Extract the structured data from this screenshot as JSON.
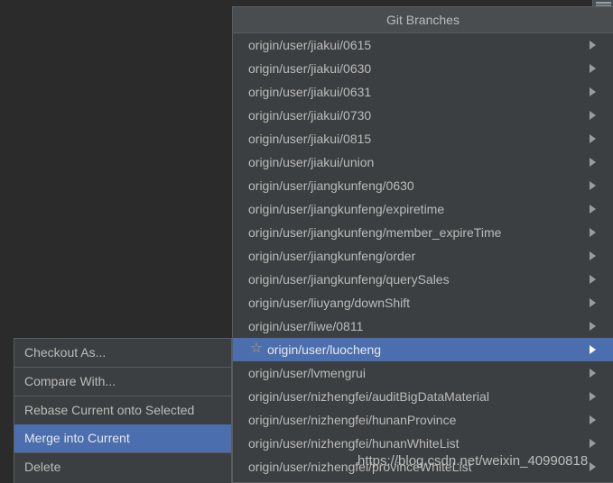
{
  "window": {
    "background_color": "#2b2b2b",
    "corner_widget_name": "scrollbar-fragment"
  },
  "branches_popup": {
    "title": "Git Branches",
    "accent_color": "#4b6eaf",
    "background_color": "#3c3f41",
    "star_color": "#d9a343",
    "items": [
      {
        "label": "origin/user/jiakui/0615",
        "starred": false,
        "selected": false,
        "has_submenu": true
      },
      {
        "label": "origin/user/jiakui/0630",
        "starred": false,
        "selected": false,
        "has_submenu": true
      },
      {
        "label": "origin/user/jiakui/0631",
        "starred": false,
        "selected": false,
        "has_submenu": true
      },
      {
        "label": "origin/user/jiakui/0730",
        "starred": false,
        "selected": false,
        "has_submenu": true
      },
      {
        "label": "origin/user/jiakui/0815",
        "starred": false,
        "selected": false,
        "has_submenu": true
      },
      {
        "label": "origin/user/jiakui/union",
        "starred": false,
        "selected": false,
        "has_submenu": true
      },
      {
        "label": "origin/user/jiangkunfeng/0630",
        "starred": false,
        "selected": false,
        "has_submenu": true
      },
      {
        "label": "origin/user/jiangkunfeng/expiretime",
        "starred": false,
        "selected": false,
        "has_submenu": true
      },
      {
        "label": "origin/user/jiangkunfeng/member_expireTime",
        "starred": false,
        "selected": false,
        "has_submenu": true
      },
      {
        "label": "origin/user/jiangkunfeng/order",
        "starred": false,
        "selected": false,
        "has_submenu": true
      },
      {
        "label": "origin/user/jiangkunfeng/querySales",
        "starred": false,
        "selected": false,
        "has_submenu": true
      },
      {
        "label": "origin/user/liuyang/downShift",
        "starred": false,
        "selected": false,
        "has_submenu": true
      },
      {
        "label": "origin/user/liwe/0811",
        "starred": false,
        "selected": false,
        "has_submenu": true
      },
      {
        "label": "origin/user/luocheng",
        "starred": true,
        "selected": true,
        "has_submenu": true
      },
      {
        "label": "origin/user/lvmengrui",
        "starred": false,
        "selected": false,
        "has_submenu": true
      },
      {
        "label": "origin/user/nizhengfei/auditBigDataMaterial",
        "starred": false,
        "selected": false,
        "has_submenu": true
      },
      {
        "label": "origin/user/nizhengfei/hunanProvince",
        "starred": false,
        "selected": false,
        "has_submenu": true
      },
      {
        "label": "origin/user/nizhengfei/hunanWhiteList",
        "starred": false,
        "selected": false,
        "has_submenu": true
      },
      {
        "label": "origin/user/nizhengfei/provinceWhiteList",
        "starred": false,
        "selected": false,
        "has_submenu": true
      }
    ],
    "star_glyph": "☆",
    "submenu_glyph": "▶"
  },
  "context_menu": {
    "highlight_color": "#4b6eaf",
    "items": [
      {
        "label": "Checkout As...",
        "highlighted": false,
        "separator_after": true
      },
      {
        "label": "Compare With...",
        "highlighted": false,
        "separator_after": true
      },
      {
        "label": "Rebase Current onto Selected",
        "highlighted": false,
        "separator_after": false
      },
      {
        "label": "Merge into Current",
        "highlighted": true,
        "separator_after": true
      },
      {
        "label": "Delete",
        "highlighted": false,
        "separator_after": false
      }
    ]
  },
  "watermark": {
    "text": "https://blog.csdn.net/weixin_40990818"
  }
}
